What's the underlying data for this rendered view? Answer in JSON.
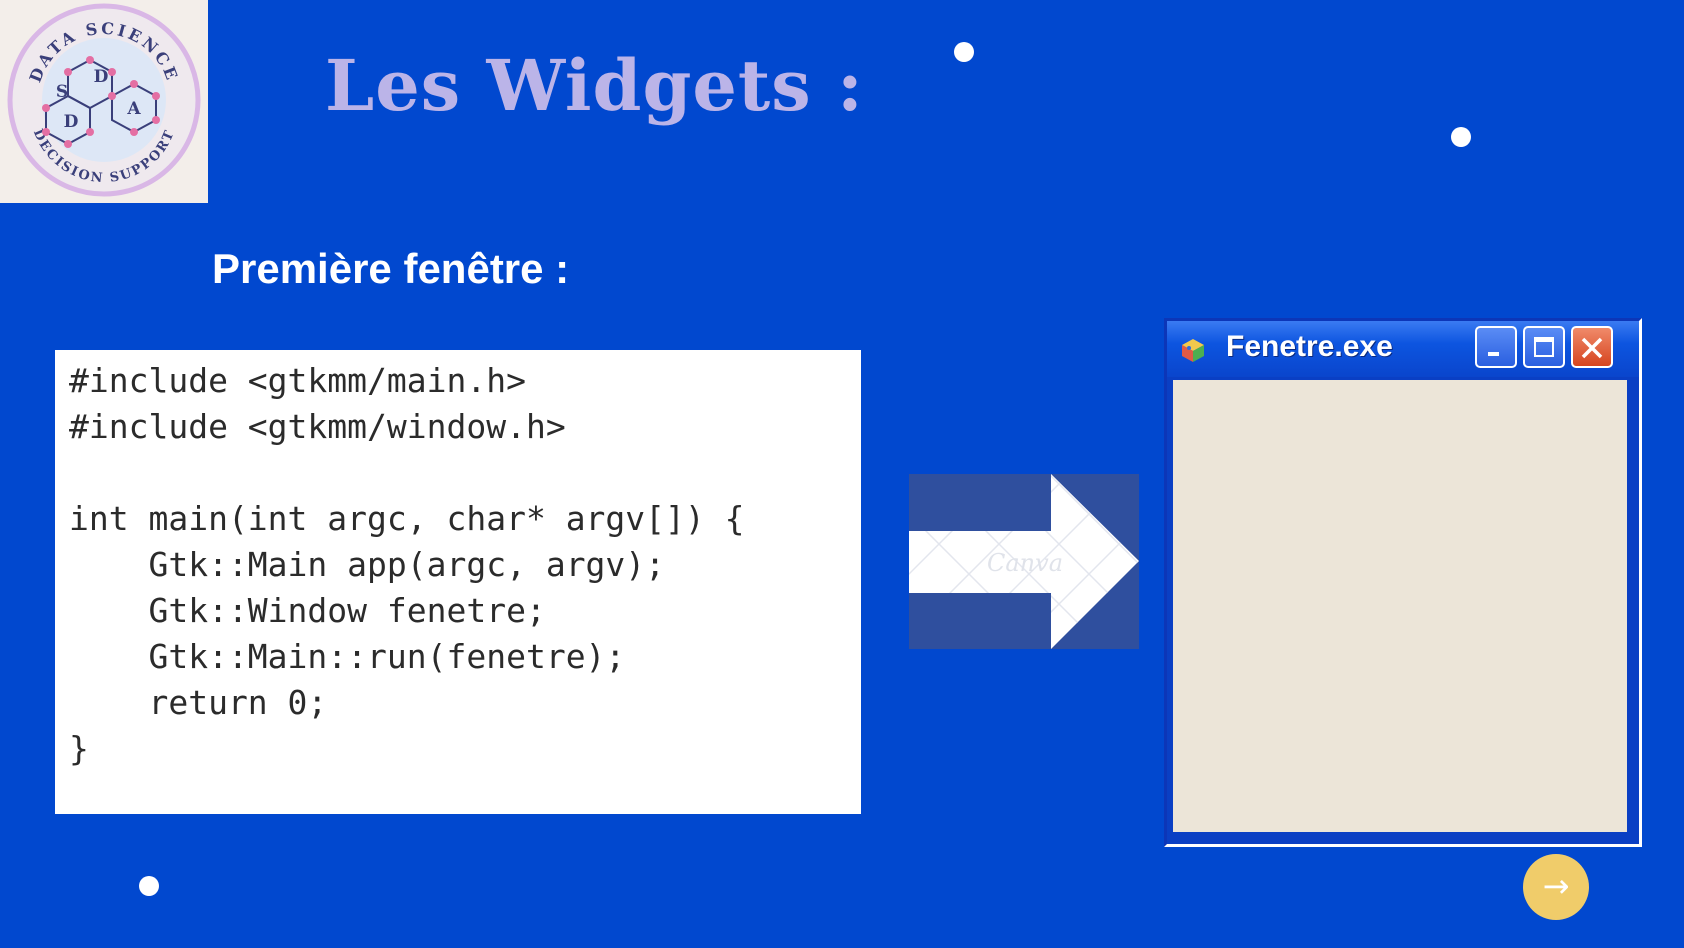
{
  "logo": {
    "top_text": "DATA SCIENCE",
    "bottom_text": "DECISION SUPPORT",
    "letters": [
      "S",
      "D",
      "D",
      "A"
    ]
  },
  "slide": {
    "title": "Les Widgets :",
    "subtitle": "Première fenêtre :"
  },
  "code": {
    "lines": [
      "#include <gtkmm/main.h>",
      "#include <gtkmm/window.h>",
      "",
      "int main(int argc, char* argv[]) {",
      "    Gtk::Main app(argc, argv);",
      "    Gtk::Window fenetre;",
      "    Gtk::Main::run(fenetre);",
      "    return 0;",
      "}"
    ]
  },
  "arrow": {
    "watermark": "Canva",
    "icon": "right-arrow-icon"
  },
  "window": {
    "title": "Fenetre.exe",
    "icon": "app-icon",
    "buttons": [
      "minimize-icon",
      "maximize-icon",
      "close-icon"
    ]
  },
  "nav": {
    "next_icon": "→"
  },
  "colors": {
    "background": "#0148CF",
    "title": "#BBB4E8",
    "next_button": "#F0CC6A",
    "window_client": "#ECE5D8"
  }
}
